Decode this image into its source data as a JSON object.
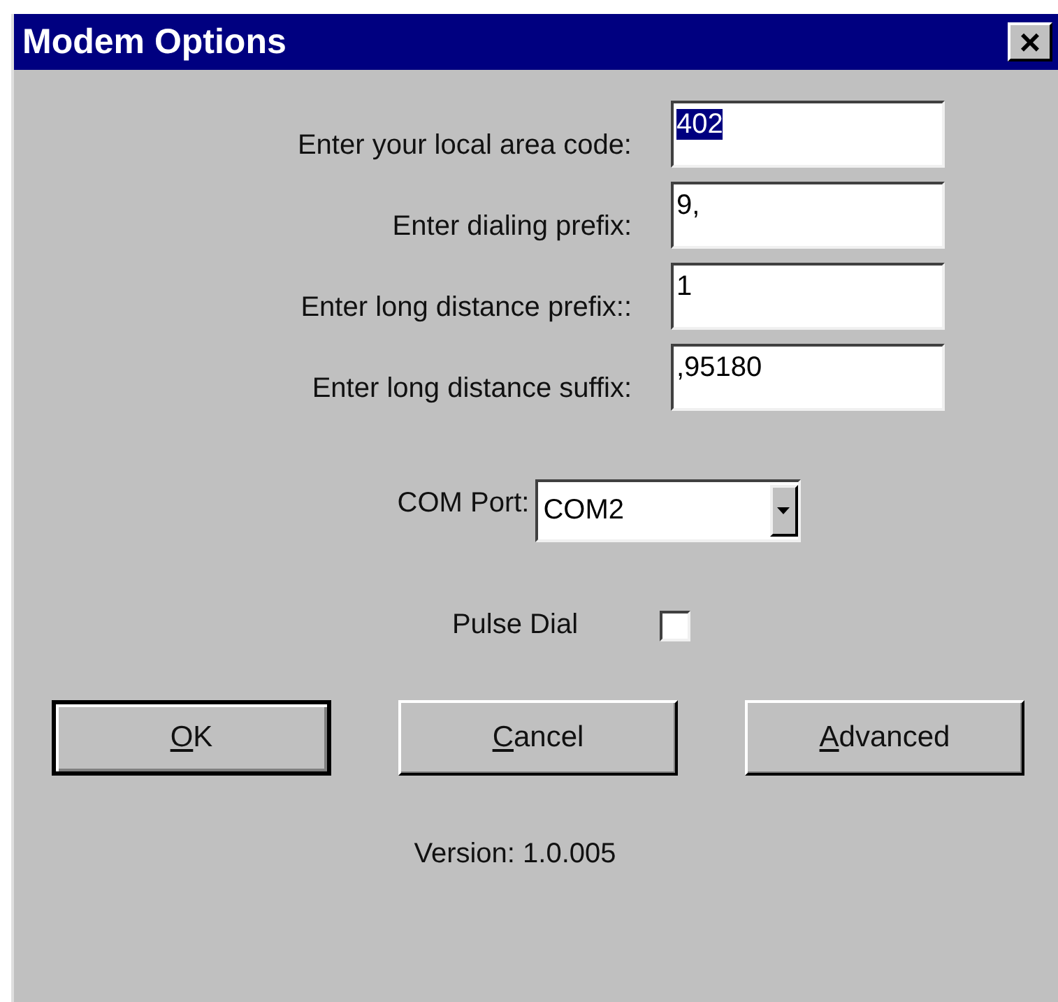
{
  "window": {
    "title": "Modem Options",
    "close_button": "×"
  },
  "fields": [
    {
      "label": "Enter your local area code:",
      "value": "402",
      "text_selected": true
    },
    {
      "label": "Enter dialing prefix:",
      "value": "9,",
      "text_selected": false
    },
    {
      "label": "Enter long distance prefix::",
      "value": "1",
      "text_selected": false
    },
    {
      "label": "Enter long distance suffix:",
      "value": ",95180",
      "text_selected": false
    }
  ],
  "com_port": {
    "label": "COM Port:",
    "value": "COM2"
  },
  "pulse_dial": {
    "label": "Pulse Dial",
    "checked": false
  },
  "buttons": [
    {
      "label": "OK",
      "default": true,
      "mnemonic_first_letter": true
    },
    {
      "label": "Cancel",
      "default": false,
      "mnemonic_first_letter": true
    },
    {
      "label": "Advanced",
      "default": false,
      "mnemonic_first_letter": true
    }
  ],
  "version": "Version: 1.0.005"
}
